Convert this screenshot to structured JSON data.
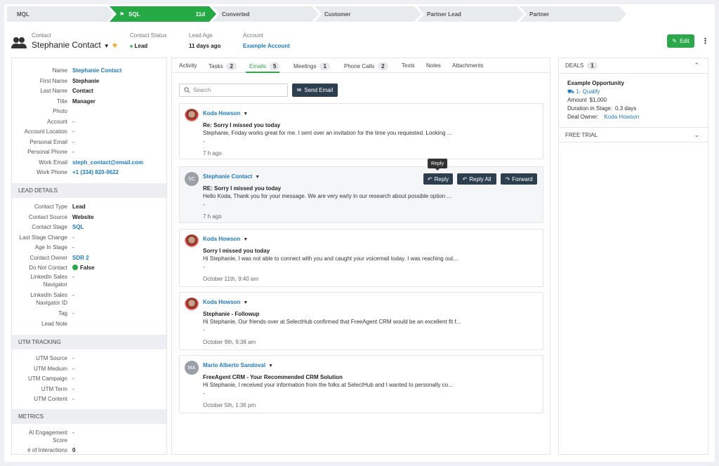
{
  "stages": [
    {
      "label": "MQL",
      "days": "",
      "active": false
    },
    {
      "label": "SQL",
      "days": "11d",
      "active": true
    },
    {
      "label": "Converted",
      "days": "",
      "active": false
    },
    {
      "label": "Customer",
      "days": "",
      "active": false
    },
    {
      "label": "Partner Lead",
      "days": "",
      "active": false
    },
    {
      "label": "Partner",
      "days": "",
      "active": false
    }
  ],
  "header": {
    "contact_label": "Contact",
    "contact_name": "Stephanie Contact",
    "status_label": "Contact Status",
    "status_value": "Lead",
    "age_label": "Lead Age",
    "age_value": "11 days ago",
    "account_label": "Account",
    "account_value": "Example Account",
    "edit_label": "Edit"
  },
  "contact_fields": [
    {
      "k": "Name",
      "v": "Stephanie Contact",
      "type": "link"
    },
    {
      "k": "First Name",
      "v": "Stephanie",
      "type": "bold"
    },
    {
      "k": "Last Name",
      "v": "Contact",
      "type": "bold"
    },
    {
      "k": "Title",
      "v": "Manager",
      "type": "bold"
    },
    {
      "k": "Photo",
      "v": "",
      "type": "plain"
    },
    {
      "k": "Account",
      "v": "-",
      "type": "plain"
    },
    {
      "k": "Account Location",
      "v": "-",
      "type": "plain"
    },
    {
      "k": "Personal Email",
      "v": "-",
      "type": "plain"
    },
    {
      "k": "Personal Phone",
      "v": "-",
      "type": "plain"
    },
    {
      "k": "Work Email",
      "v": "steph_contact@email.com",
      "type": "link"
    },
    {
      "k": "Work Phone",
      "v": "+1 (334) 820-9622",
      "type": "link"
    }
  ],
  "lead_details_title": "LEAD DETAILS",
  "lead_fields": [
    {
      "k": "Contact Type",
      "v": "Lead",
      "type": "bold"
    },
    {
      "k": "Contact Source",
      "v": "Website",
      "type": "bold"
    },
    {
      "k": "Contact Stage",
      "v": "SQL",
      "type": "link"
    },
    {
      "k": "Last Stage Change",
      "v": "-",
      "type": "plain"
    },
    {
      "k": "Age In Stage",
      "v": "-",
      "type": "plain"
    },
    {
      "k": "Contact Owner",
      "v": "SDR 2",
      "type": "link"
    },
    {
      "k": "Do Not Contact",
      "v": "False",
      "type": "bold"
    }
  ],
  "linkedin_nav_label_1": "LinkedIn Sales",
  "linkedin_nav_label_2": "Navigator",
  "linkedin_nav_value": "-",
  "linkedin_id_label_1": "LinkedIn Sales",
  "linkedin_id_label_2": "Navigator ID",
  "linkedin_id_value": "-",
  "tag_label": "Tag",
  "tag_value": "-",
  "lead_note_label": "Lead Note",
  "utm_title": "UTM TRACKING",
  "utm_fields": [
    {
      "k": "UTM Source",
      "v": "-"
    },
    {
      "k": "UTM Medium",
      "v": "-"
    },
    {
      "k": "UTM Campaign",
      "v": "-"
    },
    {
      "k": "UTM Term",
      "v": "-"
    },
    {
      "k": "UTM Content",
      "v": "-"
    }
  ],
  "metrics_title": "METRICS",
  "ai_label_1": "AI Engagement",
  "ai_label_2": "Score",
  "ai_value": "-",
  "interactions_label": "# of Interactions",
  "interactions_value": "0",
  "tabs": [
    {
      "label": "Activity",
      "count": ""
    },
    {
      "label": "Tasks",
      "count": "2"
    },
    {
      "label": "Emails",
      "count": "5"
    },
    {
      "label": "Meetings",
      "count": "1"
    },
    {
      "label": "Phone Calls",
      "count": "2"
    },
    {
      "label": "Texts",
      "count": ""
    },
    {
      "label": "Notes",
      "count": ""
    },
    {
      "label": "Attachments",
      "count": ""
    }
  ],
  "search_placeholder": "Search",
  "send_email_label": "Send Email",
  "emails": [
    {
      "sender": "Koda Howson",
      "initials": "",
      "subject": "Re: Sorry I missed you today",
      "snippet": "Stephanie, Friday works great for me. I sent over an invitation for the time you requested. Looking ...",
      "dash": "-",
      "time": "7 h ago"
    },
    {
      "sender": "Stephanie Contact",
      "initials": "SC",
      "subject": "RE: Sorry I missed you today",
      "snippet": "Hello Koda, Thank you for your message. We are very early in our research about possible option ...",
      "dash": "-",
      "time": "7 h ago"
    },
    {
      "sender": "Koda Howson",
      "initials": "",
      "subject": "Sorry I missed you today",
      "snippet": "Hi Stephanie, I was not able to connect with you and caught your voicemail today. I was reaching out...",
      "dash": "-",
      "time": "October 11th, 9:40 am"
    },
    {
      "sender": "Koda Howson",
      "initials": "",
      "subject": "Stephanie - Followup",
      "snippet": "Hi Stephanie, Our friends over at SelectHub confirmed that FreeAgent CRM would be an excellent fit f...",
      "dash": "-",
      "time": "October 9th, 9:38 am"
    },
    {
      "sender": "Mario Alberto Sandoval",
      "initials": "MA",
      "subject": "FreeAgent CRM - Your Recommended CRM Solution",
      "snippet": "Hi Stephanie, I received your information from the folks at SelectHub and I wanted to personally co...",
      "dash": "-",
      "time": "October 5th, 1:36 pm"
    }
  ],
  "actions": {
    "reply": "Reply",
    "reply_all": "Reply All",
    "forward": "Forward",
    "tooltip": "Reply"
  },
  "deals": {
    "title": "DEALS",
    "count": "1",
    "name": "Example Opportunity",
    "stage": "1- Qualify",
    "amount_label": "Amount",
    "amount_value": "$1,000",
    "duration_label": "Duration in Stage:",
    "duration_value": "0.3 days",
    "owner_label": "Deal Owner:",
    "owner_value": "Koda Howson"
  },
  "free_trial_title": "FREE TRIAL",
  "colors": {
    "accent": "#2ba84a",
    "link": "#1f7ac0",
    "dark_button": "#2d3f4e"
  }
}
